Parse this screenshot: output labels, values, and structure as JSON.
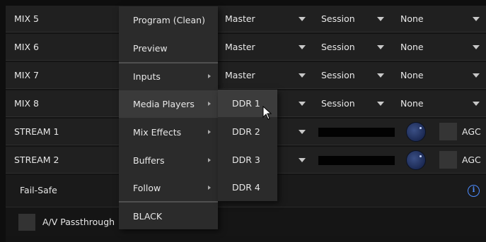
{
  "rows": [
    {
      "label": "MIX 5",
      "source": "",
      "ch1": "Master",
      "ch2": "Session",
      "ch3": "None"
    },
    {
      "label": "MIX 6",
      "source": "",
      "ch1": "Master",
      "ch2": "Session",
      "ch3": "None"
    },
    {
      "label": "MIX 7",
      "source": "",
      "ch1": "Master",
      "ch2": "Session",
      "ch3": "None"
    },
    {
      "label": "MIX 8",
      "source": "",
      "ch1": "",
      "ch2": "Session",
      "ch3": "None"
    }
  ],
  "streams": [
    {
      "label": "STREAM 1",
      "agc_label": "AGC"
    },
    {
      "label": "STREAM 2",
      "agc_label": "AGC"
    }
  ],
  "failsafe": {
    "label": "Fail-Safe",
    "info_icon": "info-icon"
  },
  "passthrough": {
    "label": "A/V Passthrough"
  },
  "menu": {
    "items": [
      {
        "label": "Program (Clean)",
        "submenu": false
      },
      {
        "label": "Preview",
        "submenu": false
      },
      {
        "label": "Inputs",
        "submenu": true
      },
      {
        "label": "Media Players",
        "submenu": true,
        "highlighted": true
      },
      {
        "label": "Mix Effects",
        "submenu": true
      },
      {
        "label": "Buffers",
        "submenu": true
      },
      {
        "label": "Follow",
        "submenu": true
      },
      {
        "label": "BLACK",
        "submenu": false
      }
    ]
  },
  "submenu": {
    "items": [
      {
        "label": "DDR 1",
        "highlighted": true
      },
      {
        "label": "DDR 2"
      },
      {
        "label": "DDR 3"
      },
      {
        "label": "DDR 4"
      }
    ]
  },
  "colors": {
    "info_accent": "#4d8cff",
    "knob": "#2a3c6e"
  }
}
